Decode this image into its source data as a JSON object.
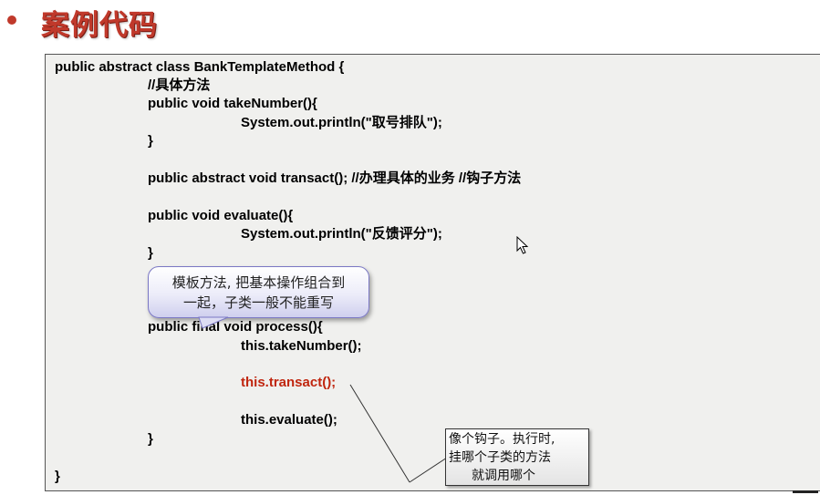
{
  "slide": {
    "title": "案例代码"
  },
  "code": {
    "lines": [
      "public abstract class BankTemplateMethod {",
      "//具体方法",
      "public void takeNumber(){",
      "System.out.println(\"取号排队\");",
      "}",
      "public abstract void transact(); //办理具体的业务     //钩子方法",
      "public void evaluate(){",
      "System.out.println(\"反馈评分\");",
      "}",
      "public final void process(){",
      "this.takeNumber();",
      "this.transact();",
      "this.evaluate();",
      "}",
      "}"
    ]
  },
  "callouts": {
    "template_method_note_line1": "模板方法, 把基本操作组合到",
    "template_method_note_line2": "一起，子类一般不能重写",
    "hook_note_line1": "像个钩子。执行时,",
    "hook_note_line2": "挂哪个子类的方法",
    "hook_note_line3": "就调用哪个"
  },
  "colors": {
    "title": "#c0392b",
    "highlight_code": "#c0260f",
    "code_background": "#f0f0ee"
  }
}
